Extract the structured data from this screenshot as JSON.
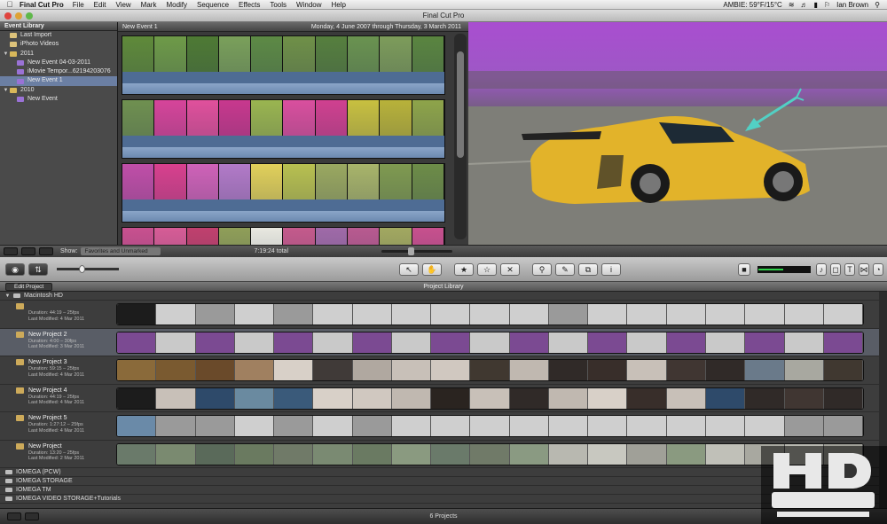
{
  "menubar": {
    "app": "Final Cut Pro",
    "items": [
      "File",
      "Edit",
      "View",
      "Mark",
      "Modify",
      "Sequence",
      "Effects",
      "Tools",
      "Window",
      "Help"
    ],
    "weather": "AMBIE: 59°F/15°C",
    "user": "Ian Brown"
  },
  "window": {
    "title": "Final Cut Pro"
  },
  "event_library": {
    "title": "Event Library",
    "items": [
      {
        "label": "Last Import",
        "type": "star",
        "level": 0,
        "expanded": null
      },
      {
        "label": "iPhoto Videos",
        "type": "star",
        "level": 0,
        "expanded": null
      },
      {
        "label": "2011",
        "type": "folder",
        "level": 0,
        "expanded": true
      },
      {
        "label": "New Event 04-03-2011",
        "type": "event",
        "level": 1,
        "expanded": null
      },
      {
        "label": "iMovie Tempor...62194203076",
        "type": "event",
        "level": 1,
        "expanded": null
      },
      {
        "label": "New Event 1",
        "type": "event",
        "level": 1,
        "expanded": null,
        "selected": true
      },
      {
        "label": "2010",
        "type": "folder",
        "level": 0,
        "expanded": true
      },
      {
        "label": "New Event",
        "type": "event",
        "level": 1,
        "expanded": null
      }
    ]
  },
  "event_browser": {
    "title": "New Event 1",
    "date_range": "Monday, 4 June 2007 through Thursday, 3 March 2011",
    "rows": [
      {
        "thumb_colors": [
          "#5f8a3a",
          "#6e9a48",
          "#4e7a34",
          "#7aa05a",
          "#5d8a45",
          "#6f9048",
          "#567f3e",
          "#6a9350",
          "#7d9c5a",
          "#5a8540"
        ]
      },
      {
        "thumb_colors": [
          "#6f9050",
          "#d6449a",
          "#e0509c",
          "#c8388e",
          "#9ab550",
          "#d94f9e",
          "#d04090",
          "#c8c040",
          "#b8b23a",
          "#8ea44a"
        ]
      },
      {
        "thumb_colors": [
          "#c04ea8",
          "#d8408e",
          "#cf62b8",
          "#b27ac8",
          "#e1d05a",
          "#b8c050",
          "#9aa860",
          "#a8b46a",
          "#7f9a50",
          "#6d8c48"
        ]
      },
      {
        "thumb_colors": [
          "#c8508f",
          "#d65c96",
          "#c0406e",
          "#8f9e58",
          "#e8e8e0",
          "#c45a8c",
          "#9f6aa8",
          "#b85a90",
          "#a2a860",
          "#c7508e"
        ]
      }
    ]
  },
  "browser_controls": {
    "show_label": "Show:",
    "show_value": "Favorites and Unmarked",
    "total": "7:19:24 total"
  },
  "toolbar": {
    "buttons": [
      {
        "name": "select-tool",
        "glyph": "↖"
      },
      {
        "name": "hand-tool",
        "glyph": "✋"
      },
      {
        "name": "favorite",
        "glyph": "★"
      },
      {
        "name": "unmark",
        "glyph": "☆"
      },
      {
        "name": "reject",
        "glyph": "✕"
      },
      {
        "name": "keyword",
        "glyph": "⚲"
      },
      {
        "name": "adjust-tool",
        "glyph": "✎"
      },
      {
        "name": "crop",
        "glyph": "⧉"
      },
      {
        "name": "inspector",
        "glyph": "i"
      }
    ]
  },
  "project_library": {
    "edit_label": "Edit Project",
    "title": "Project Library",
    "drive": "Macintosh HD",
    "projects": [
      {
        "name": "",
        "duration": "Duration: 44:19 – 25fps",
        "modified": "Last Modified: 4 Mar 2011",
        "selected": false,
        "frames": [
          "#1c1c1c",
          "#cfcfcf",
          "#9a9a9a",
          "#cfcfcf",
          "#9a9a9a",
          "#cfcfcf",
          "#cfcfcf",
          "#cfcfcf",
          "#cfcfcf",
          "#cfcfcf",
          "#cfcfcf",
          "#9a9a9a",
          "#cfcfcf",
          "#cfcfcf",
          "#cfcfcf",
          "#cfcfcf",
          "#cfcfcf",
          "#cfcfcf",
          "#cfcfcf"
        ]
      },
      {
        "name": "New Project 2",
        "duration": "Duration: 4:00 – 30fps",
        "modified": "Last Modified: 3 Mar 2011",
        "selected": true,
        "frames": [
          "#7b4a92",
          "#c9c9c9",
          "#7b4a92",
          "#c9c9c9",
          "#7b4a92",
          "#c9c9c9",
          "#7b4a92",
          "#c9c9c9",
          "#7b4a92",
          "#c9c9c9",
          "#7b4a92",
          "#c9c9c9",
          "#7b4a92",
          "#c9c9c9",
          "#7b4a92",
          "#c9c9c9",
          "#7b4a92",
          "#c9c9c9",
          "#7b4a92"
        ]
      },
      {
        "name": "New Project 3",
        "duration": "Duration: 59:15 – 25fps",
        "modified": "Last Modified: 4 Mar 2011",
        "selected": false,
        "frames": [
          "#8a6a3a",
          "#7a5a30",
          "#6a4a2a",
          "#a08060",
          "#d8d0c8",
          "#403a38",
          "#b0a8a0",
          "#c8c0b8",
          "#d0c8c0",
          "#403830",
          "#c0b8b0",
          "#302a28",
          "#382e2a",
          "#c8c0b8",
          "#403632",
          "#302a28",
          "#6a7a8a",
          "#a8a8a0",
          "#403830"
        ]
      },
      {
        "name": "New Project 4",
        "duration": "Duration: 44:19 – 25fps",
        "modified": "Last Modified: 4 Mar 2011",
        "selected": false,
        "frames": [
          "#1c1c1c",
          "#c8c0b8",
          "#2e4a6a",
          "#6a8aa0",
          "#3a5a7a",
          "#d8d0c8",
          "#d0c8c0",
          "#c0b8b0",
          "#2a2420",
          "#c8c0b8",
          "#302a28",
          "#c0b8b0",
          "#d8d0c8",
          "#382e2a",
          "#c8c0b8",
          "#2e4a6a",
          "#302a28",
          "#403632",
          "#302a28"
        ]
      },
      {
        "name": "New Project 5",
        "duration": "Duration: 1:27:12 – 25fps",
        "modified": "Last Modified: 4 Mar 2011",
        "selected": false,
        "frames": [
          "#6a8aa8",
          "#9a9a9a",
          "#9a9a9a",
          "#cfcfcf",
          "#9a9a9a",
          "#cfcfcf",
          "#9a9a9a",
          "#cfcfcf",
          "#cfcfcf",
          "#cfcfcf",
          "#cfcfcf",
          "#cfcfcf",
          "#cfcfcf",
          "#cfcfcf",
          "#cfcfcf",
          "#cfcfcf",
          "#cfcfcf",
          "#9a9a9a",
          "#9a9a9a"
        ]
      },
      {
        "name": "New Project",
        "duration": "Duration: 13:20 – 25fps",
        "modified": "Last Modified: 2 Mar 2011",
        "selected": false,
        "frames": [
          "#6a7a6a",
          "#7a8a70",
          "#5a6a5a",
          "#6a7a60",
          "#707a68",
          "#7a8a72",
          "#6a7a62",
          "#8a9a80",
          "#6a7a6a",
          "#707a68",
          "#8a9a82",
          "#b8b8b0",
          "#c8c8c0",
          "#a0a098",
          "#8a9a80",
          "#c0c0b8",
          "#a8a8a0",
          "#b8b8b0",
          "#a0a098"
        ]
      }
    ],
    "drives": [
      "IOMEGA (PCW)",
      "IOMEGA STORAGE",
      "IOMEGA TM",
      "IOMEGA VIDEO STORAGE+Tutorials"
    ],
    "count": "6 Projects"
  },
  "colors": {
    "selection": "#6b7fa3",
    "waveform": "#4e6c94",
    "viewer_sky": "#a94ed0",
    "car": "#e2b32a"
  }
}
